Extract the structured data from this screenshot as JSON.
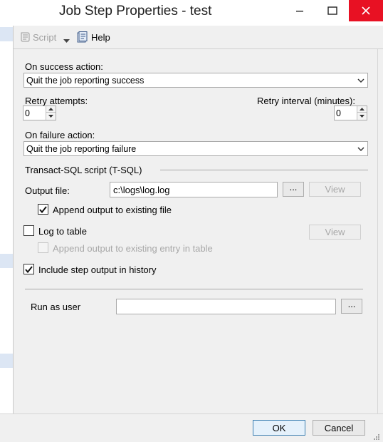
{
  "window": {
    "title": "Job Step Properties - test"
  },
  "toolbar": {
    "script_label": "Script",
    "help_label": "Help"
  },
  "on_success": {
    "label": "On success action:",
    "selected": "Quit the job reporting success"
  },
  "retry": {
    "attempts_label": "Retry attempts:",
    "attempts_value": "0",
    "interval_label": "Retry interval (minutes):",
    "interval_value": "0"
  },
  "on_failure": {
    "label": "On failure action:",
    "selected": "Quit the job reporting failure"
  },
  "tsql": {
    "group_label": "Transact-SQL script (T-SQL)",
    "output_file_label": "Output file:",
    "output_file_value": "c:\\logs\\log.log",
    "browse_label": "...",
    "view_label": "View",
    "append_output_label": "Append output to existing file",
    "append_output_checked": true,
    "log_to_table_label": "Log to table",
    "log_to_table_checked": false,
    "table_view_label": "View",
    "append_table_label": "Append output to existing entry in table",
    "append_table_checked": false,
    "include_history_label": "Include step output in history",
    "include_history_checked": true
  },
  "run_as": {
    "label": "Run as user",
    "value": "",
    "browse_label": "..."
  },
  "footer": {
    "ok_label": "OK",
    "cancel_label": "Cancel"
  },
  "colors": {
    "close_button": "#e81123",
    "default_button_border": "#3c7fb1",
    "left_strip_band": "#dce6f4"
  },
  "icons": [
    "script-icon",
    "dropdown-arrow-icon",
    "help-icon",
    "minimize-icon",
    "maximize-icon",
    "close-icon",
    "chevron-down-icon",
    "checkmark-icon"
  ]
}
